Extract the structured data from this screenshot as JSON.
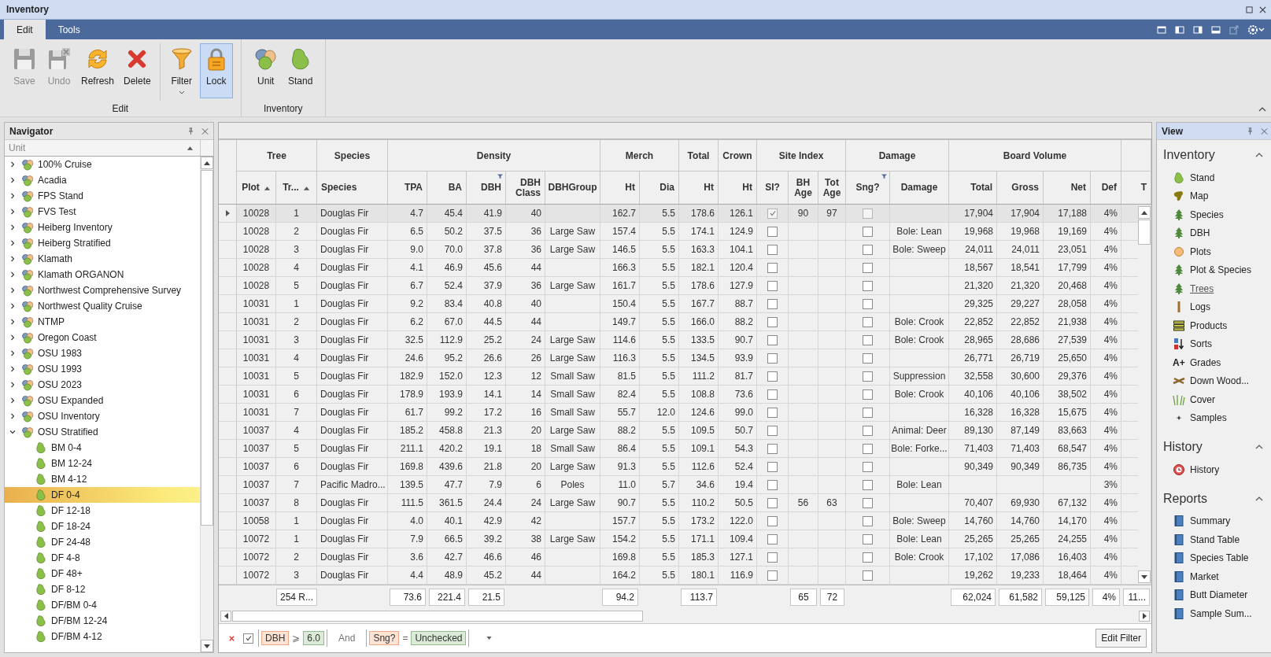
{
  "window": {
    "title": "Inventory"
  },
  "tabs": [
    {
      "label": "Edit",
      "selected": true
    },
    {
      "label": "Tools",
      "selected": false
    }
  ],
  "ribbon": {
    "groups": [
      {
        "label": "Edit",
        "sets": [
          {
            "buttons": [
              {
                "label": "Save",
                "kind": "save",
                "disabled": true,
                "on": false,
                "dropdown": false
              },
              {
                "label": "Undo",
                "kind": "undo",
                "disabled": true,
                "on": false,
                "dropdown": false
              },
              {
                "label": "Refresh",
                "kind": "refresh",
                "disabled": false,
                "on": false,
                "dropdown": false
              },
              {
                "label": "Delete",
                "kind": "delete",
                "disabled": false,
                "on": false,
                "dropdown": false
              }
            ]
          },
          {
            "buttons": [
              {
                "label": "Filter",
                "kind": "filter",
                "disabled": false,
                "on": false,
                "dropdown": true
              },
              {
                "label": "Lock",
                "kind": "lock",
                "disabled": false,
                "on": true,
                "dropdown": false
              }
            ]
          }
        ]
      },
      {
        "label": "Inventory",
        "sets": [
          {
            "buttons": [
              {
                "label": "Unit",
                "kind": "unit",
                "disabled": false,
                "on": false,
                "dropdown": false
              },
              {
                "label": "Stand",
                "kind": "stand",
                "disabled": false,
                "on": false,
                "dropdown": false
              }
            ]
          }
        ]
      }
    ]
  },
  "navigator": {
    "title": "Navigator",
    "column": "Unit",
    "units": [
      {
        "label": "100% Cruise",
        "expanded": false,
        "selected": false
      },
      {
        "label": "Acadia",
        "expanded": false,
        "selected": false
      },
      {
        "label": "FPS Stand",
        "expanded": false,
        "selected": false
      },
      {
        "label": "FVS Test",
        "expanded": false,
        "selected": false
      },
      {
        "label": "Heiberg Inventory",
        "expanded": false,
        "selected": false
      },
      {
        "label": "Heiberg Stratified",
        "expanded": false,
        "selected": false
      },
      {
        "label": "Klamath",
        "expanded": false,
        "selected": false
      },
      {
        "label": "Klamath ORGANON",
        "expanded": false,
        "selected": false
      },
      {
        "label": "Northwest Comprehensive Survey",
        "expanded": false,
        "selected": false
      },
      {
        "label": "Northwest Quality Cruise",
        "expanded": false,
        "selected": false
      },
      {
        "label": "NTMP",
        "expanded": false,
        "selected": false
      },
      {
        "label": "Oregon Coast",
        "expanded": false,
        "selected": false
      },
      {
        "label": "OSU 1983",
        "expanded": false,
        "selected": false
      },
      {
        "label": "OSU 1993",
        "expanded": false,
        "selected": false
      },
      {
        "label": "OSU 2023",
        "expanded": false,
        "selected": false
      },
      {
        "label": "OSU Expanded",
        "expanded": false,
        "selected": false
      },
      {
        "label": "OSU Inventory",
        "expanded": false,
        "selected": false
      },
      {
        "label": "OSU Stratified",
        "expanded": true,
        "selected": false,
        "children": [
          {
            "label": "BM 0-4",
            "selected": false
          },
          {
            "label": "BM 12-24",
            "selected": false
          },
          {
            "label": "BM 4-12",
            "selected": false
          },
          {
            "label": "DF 0-4",
            "selected": true
          },
          {
            "label": "DF 12-18",
            "selected": false
          },
          {
            "label": "DF 18-24",
            "selected": false
          },
          {
            "label": "DF 24-48",
            "selected": false
          },
          {
            "label": "DF 4-8",
            "selected": false
          },
          {
            "label": "DF 48+",
            "selected": false
          },
          {
            "label": "DF 8-12",
            "selected": false
          },
          {
            "label": "DF/BM 0-4",
            "selected": false
          },
          {
            "label": "DF/BM 12-24",
            "selected": false
          },
          {
            "label": "DF/BM 4-12",
            "selected": false
          }
        ]
      }
    ]
  },
  "table": {
    "groups": [
      {
        "label": "Tree",
        "columns": [
          {
            "label": "Plot",
            "kind": "id",
            "sorted": true,
            "filtered": false
          },
          {
            "label": "Tr...",
            "kind": "id",
            "sorted": true,
            "filtered": false,
            "total": "254 R..."
          }
        ]
      },
      {
        "label": "Species",
        "columns": [
          {
            "label": "Species",
            "kind": "text",
            "sorted": false,
            "filtered": false
          }
        ]
      },
      {
        "label": "Density",
        "columns": [
          {
            "label": "TPA",
            "kind": "number",
            "sorted": false,
            "filtered": false,
            "total": "73.6"
          },
          {
            "label": "BA",
            "kind": "number",
            "sorted": false,
            "filtered": false,
            "total": "221.4"
          },
          {
            "label": "DBH",
            "kind": "number",
            "sorted": false,
            "filtered": true,
            "total": "21.5"
          },
          {
            "label": "DBH Class",
            "kind": "number",
            "sorted": false,
            "filtered": false
          },
          {
            "label": "DBHGroup",
            "kind": "label",
            "sorted": false,
            "filtered": false
          }
        ]
      },
      {
        "label": "Merch",
        "columns": [
          {
            "label": "Ht",
            "kind": "number",
            "sorted": false,
            "filtered": false,
            "total": "94.2"
          },
          {
            "label": "Dia",
            "kind": "number",
            "sorted": false,
            "filtered": false
          }
        ]
      },
      {
        "label": "Total",
        "columns": [
          {
            "label": "Ht",
            "kind": "number",
            "sorted": false,
            "filtered": false,
            "total": "113.7"
          }
        ]
      },
      {
        "label": "Crown",
        "columns": [
          {
            "label": "Ht",
            "kind": "number",
            "sorted": false,
            "filtered": false
          }
        ]
      },
      {
        "label": "Site Index",
        "columns": [
          {
            "label": "SI?",
            "kind": "check",
            "sorted": false,
            "filtered": false
          },
          {
            "label": "BH Age",
            "kind": "id",
            "sorted": false,
            "filtered": false,
            "total": "65"
          },
          {
            "label": "Tot Age",
            "kind": "id",
            "sorted": false,
            "filtered": false,
            "total": "72"
          }
        ]
      },
      {
        "label": "Damage",
        "columns": [
          {
            "label": "Sng?",
            "kind": "check",
            "sorted": false,
            "filtered": true
          },
          {
            "label": "Damage",
            "kind": "label",
            "sorted": false,
            "filtered": false
          }
        ]
      },
      {
        "label": "Board Volume",
        "columns": [
          {
            "label": "Total",
            "kind": "number",
            "sorted": false,
            "filtered": false,
            "total": "62,024"
          },
          {
            "label": "Gross",
            "kind": "number",
            "sorted": false,
            "filtered": false,
            "total": "61,582"
          },
          {
            "label": "Net",
            "kind": "number",
            "sorted": false,
            "filtered": false,
            "total": "59,125"
          },
          {
            "label": "Def",
            "kind": "number",
            "sorted": false,
            "filtered": false,
            "total": "4%"
          }
        ]
      },
      {
        "columns": [
          {
            "label": "T",
            "kind": "number",
            "sorted": false,
            "filtered": false,
            "total": "11..."
          }
        ]
      }
    ],
    "rows": [
      {
        "selected": true,
        "cells": [
          "10028",
          "1",
          "Douglas Fir",
          "4.7",
          "45.4",
          "41.9",
          "40",
          null,
          "162.7",
          "5.5",
          "178.6",
          "126.1",
          true,
          "90",
          "97",
          false,
          null,
          "17,904",
          "17,904",
          "17,188",
          "4%"
        ]
      },
      {
        "selected": false,
        "cells": [
          "10028",
          "2",
          "Douglas Fir",
          "6.5",
          "50.2",
          "37.5",
          "36",
          "Large Saw",
          "157.4",
          "5.5",
          "174.1",
          "124.9",
          false,
          null,
          null,
          false,
          "Bole: Lean",
          "19,968",
          "19,968",
          "19,169",
          "4%"
        ]
      },
      {
        "selected": false,
        "cells": [
          "10028",
          "3",
          "Douglas Fir",
          "9.0",
          "70.0",
          "37.8",
          "36",
          "Large Saw",
          "146.5",
          "5.5",
          "163.3",
          "104.1",
          false,
          null,
          null,
          false,
          "Bole: Sweep",
          "24,011",
          "24,011",
          "23,051",
          "4%"
        ]
      },
      {
        "selected": false,
        "cells": [
          "10028",
          "4",
          "Douglas Fir",
          "4.1",
          "46.9",
          "45.6",
          "44",
          null,
          "166.3",
          "5.5",
          "182.1",
          "120.4",
          false,
          null,
          null,
          false,
          null,
          "18,567",
          "18,541",
          "17,799",
          "4%"
        ]
      },
      {
        "selected": false,
        "cells": [
          "10028",
          "5",
          "Douglas Fir",
          "6.7",
          "52.4",
          "37.9",
          "36",
          "Large Saw",
          "161.7",
          "5.5",
          "178.6",
          "127.9",
          false,
          null,
          null,
          false,
          null,
          "21,320",
          "21,320",
          "20,468",
          "4%"
        ]
      },
      {
        "selected": false,
        "cells": [
          "10031",
          "1",
          "Douglas Fir",
          "9.2",
          "83.4",
          "40.8",
          "40",
          null,
          "150.4",
          "5.5",
          "167.7",
          "88.7",
          false,
          null,
          null,
          false,
          null,
          "29,325",
          "29,227",
          "28,058",
          "4%"
        ]
      },
      {
        "selected": false,
        "cells": [
          "10031",
          "2",
          "Douglas Fir",
          "6.2",
          "67.0",
          "44.5",
          "44",
          null,
          "149.7",
          "5.5",
          "166.0",
          "88.2",
          false,
          null,
          null,
          false,
          "Bole: Crook",
          "22,852",
          "22,852",
          "21,938",
          "4%"
        ]
      },
      {
        "selected": false,
        "cells": [
          "10031",
          "3",
          "Douglas Fir",
          "32.5",
          "112.9",
          "25.2",
          "24",
          "Large Saw",
          "114.6",
          "5.5",
          "133.5",
          "90.7",
          false,
          null,
          null,
          false,
          "Bole: Crook",
          "28,965",
          "28,686",
          "27,539",
          "4%"
        ]
      },
      {
        "selected": false,
        "cells": [
          "10031",
          "4",
          "Douglas Fir",
          "24.6",
          "95.2",
          "26.6",
          "26",
          "Large Saw",
          "116.3",
          "5.5",
          "134.5",
          "93.9",
          false,
          null,
          null,
          false,
          null,
          "26,771",
          "26,719",
          "25,650",
          "4%"
        ]
      },
      {
        "selected": false,
        "cells": [
          "10031",
          "5",
          "Douglas Fir",
          "182.9",
          "152.0",
          "12.3",
          "12",
          "Small Saw",
          "81.5",
          "5.5",
          "111.2",
          "81.7",
          false,
          null,
          null,
          false,
          "Suppression",
          "32,558",
          "30,600",
          "29,376",
          "4%"
        ]
      },
      {
        "selected": false,
        "cells": [
          "10031",
          "6",
          "Douglas Fir",
          "178.9",
          "193.9",
          "14.1",
          "14",
          "Small Saw",
          "82.4",
          "5.5",
          "108.8",
          "73.6",
          false,
          null,
          null,
          false,
          "Bole: Crook",
          "40,106",
          "40,106",
          "38,502",
          "4%"
        ]
      },
      {
        "selected": false,
        "cells": [
          "10031",
          "7",
          "Douglas Fir",
          "61.7",
          "99.2",
          "17.2",
          "16",
          "Small Saw",
          "55.7",
          "12.0",
          "124.6",
          "99.0",
          false,
          null,
          null,
          false,
          null,
          "16,328",
          "16,328",
          "15,675",
          "4%"
        ]
      },
      {
        "selected": false,
        "cells": [
          "10037",
          "4",
          "Douglas Fir",
          "185.2",
          "458.8",
          "21.3",
          "20",
          "Large Saw",
          "88.2",
          "5.5",
          "109.5",
          "50.7",
          false,
          null,
          null,
          false,
          "Animal: Deer",
          "89,130",
          "87,149",
          "83,663",
          "4%"
        ]
      },
      {
        "selected": false,
        "cells": [
          "10037",
          "5",
          "Douglas Fir",
          "211.1",
          "420.2",
          "19.1",
          "18",
          "Small Saw",
          "86.4",
          "5.5",
          "109.1",
          "54.3",
          false,
          null,
          null,
          false,
          "Bole: Forke...",
          "71,403",
          "71,403",
          "68,547",
          "4%"
        ]
      },
      {
        "selected": false,
        "cells": [
          "10037",
          "6",
          "Douglas Fir",
          "169.8",
          "439.6",
          "21.8",
          "20",
          "Large Saw",
          "91.3",
          "5.5",
          "112.6",
          "52.4",
          false,
          null,
          null,
          false,
          null,
          "90,349",
          "90,349",
          "86,735",
          "4%"
        ]
      },
      {
        "selected": false,
        "cells": [
          "10037",
          "7",
          "Pacific Madro...",
          "139.5",
          "47.7",
          "7.9",
          "6",
          "Poles",
          "11.0",
          "5.7",
          "34.6",
          "19.4",
          false,
          null,
          null,
          false,
          "Bole: Lean",
          null,
          null,
          null,
          "3%"
        ]
      },
      {
        "selected": false,
        "cells": [
          "10037",
          "8",
          "Douglas Fir",
          "111.5",
          "361.5",
          "24.4",
          "24",
          "Large Saw",
          "90.7",
          "5.5",
          "110.2",
          "50.5",
          false,
          "56",
          "63",
          false,
          null,
          "70,407",
          "69,930",
          "67,132",
          "4%"
        ]
      },
      {
        "selected": false,
        "cells": [
          "10058",
          "1",
          "Douglas Fir",
          "4.0",
          "40.1",
          "42.9",
          "42",
          null,
          "157.7",
          "5.5",
          "173.2",
          "122.0",
          false,
          null,
          null,
          false,
          "Bole: Sweep",
          "14,760",
          "14,760",
          "14,170",
          "4%"
        ]
      },
      {
        "selected": false,
        "cells": [
          "10072",
          "1",
          "Douglas Fir",
          "7.9",
          "66.5",
          "39.2",
          "38",
          "Large Saw",
          "154.2",
          "5.5",
          "171.1",
          "109.4",
          false,
          null,
          null,
          false,
          "Bole: Lean",
          "25,265",
          "25,265",
          "24,255",
          "4%"
        ]
      },
      {
        "selected": false,
        "cells": [
          "10072",
          "2",
          "Douglas Fir",
          "3.6",
          "42.7",
          "46.6",
          "46",
          null,
          "169.8",
          "5.5",
          "185.3",
          "127.1",
          false,
          null,
          null,
          false,
          "Bole: Crook",
          "17,102",
          "17,086",
          "16,403",
          "4%"
        ]
      },
      {
        "selected": false,
        "cells": [
          "10072",
          "3",
          "Douglas Fir",
          "4.4",
          "48.9",
          "45.2",
          "44",
          null,
          "164.2",
          "5.5",
          "180.1",
          "116.9",
          false,
          null,
          null,
          false,
          null,
          "19,262",
          "19,233",
          "18,464",
          "4%"
        ]
      }
    ]
  },
  "filter": {
    "enabled": true,
    "conditions": [
      {
        "field": "DBH",
        "operator": "⩾",
        "value": "6.0"
      },
      {
        "field": "Sng?",
        "operator": "=",
        "value": "Unchecked"
      }
    ],
    "joiner": "And",
    "button": "Edit Filter"
  },
  "view_panel": {
    "title": "View",
    "sections": [
      {
        "title": "Inventory",
        "expanded": true,
        "items": [
          {
            "label": "Stand",
            "kind": "stand",
            "selected": false
          },
          {
            "label": "Map",
            "kind": "map",
            "selected": false
          },
          {
            "label": "Species",
            "kind": "tree",
            "selected": false
          },
          {
            "label": "DBH",
            "kind": "tree",
            "selected": false
          },
          {
            "label": "Plots",
            "kind": "plot",
            "selected": false
          },
          {
            "label": "Plot & Species",
            "kind": "tree",
            "selected": false
          },
          {
            "label": "Trees",
            "kind": "tree",
            "selected": true
          },
          {
            "label": "Logs",
            "kind": "log",
            "selected": false
          },
          {
            "label": "Products",
            "kind": "products",
            "selected": false
          },
          {
            "label": "Sorts",
            "kind": "sorts",
            "selected": false
          },
          {
            "label": "Grades",
            "kind": "text",
            "glyph": "A+",
            "selected": false
          },
          {
            "label": "Down Wood...",
            "kind": "downwood",
            "selected": false
          },
          {
            "label": "Cover",
            "kind": "cover",
            "selected": false
          },
          {
            "label": "Samples",
            "kind": "samples",
            "selected": false
          }
        ]
      },
      {
        "title": "History",
        "expanded": true,
        "items": [
          {
            "label": "History",
            "kind": "history",
            "selected": false
          }
        ]
      },
      {
        "title": "Reports",
        "expanded": true,
        "items": [
          {
            "label": "Summary",
            "kind": "report",
            "selected": false
          },
          {
            "label": "Stand Table",
            "kind": "report",
            "selected": false
          },
          {
            "label": "Species Table",
            "kind": "report",
            "selected": false
          },
          {
            "label": "Market",
            "kind": "report",
            "selected": false
          },
          {
            "label": "Butt Diameter",
            "kind": "report",
            "selected": false
          },
          {
            "label": "Sample Sum...",
            "kind": "report",
            "selected": false
          }
        ]
      }
    ]
  }
}
